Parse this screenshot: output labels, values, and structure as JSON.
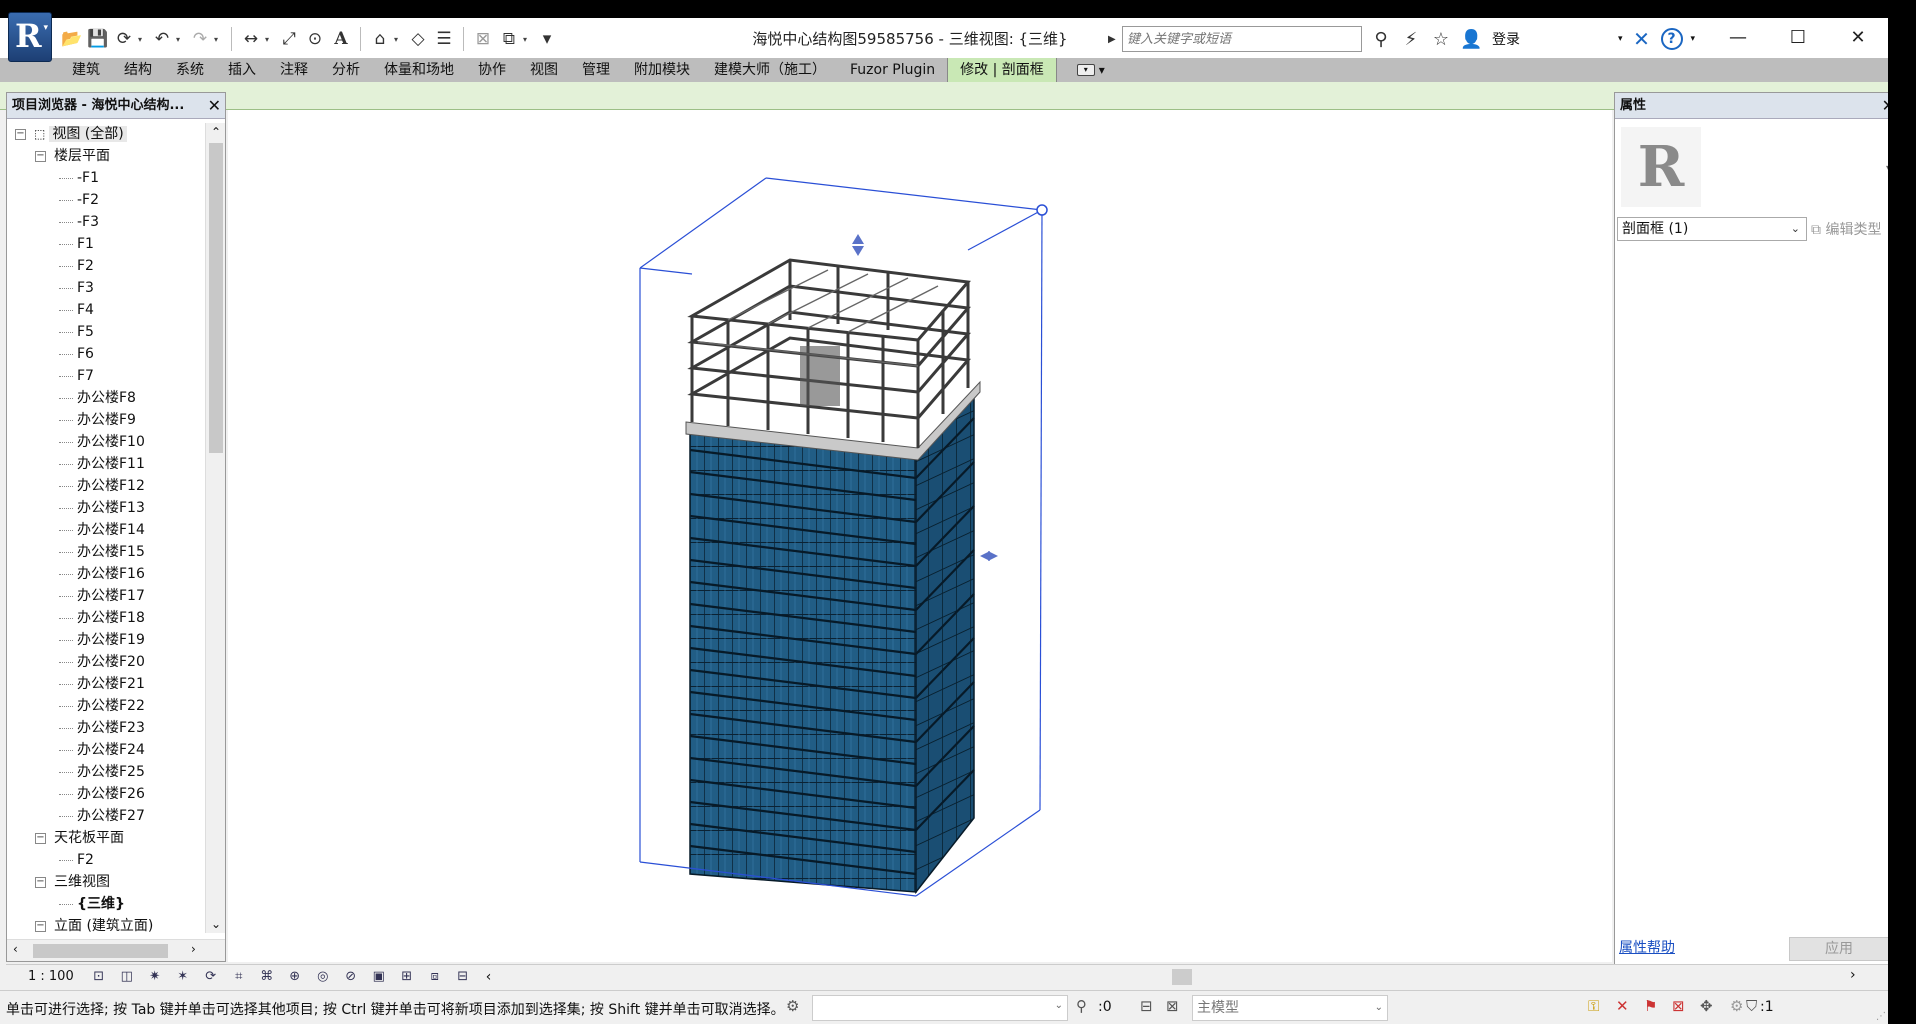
{
  "window": {
    "title": "海悦中心结构图59585756 - 三维视图: {三维}",
    "controls": {
      "minimize": "—",
      "maximize": "☐",
      "close": "✕"
    }
  },
  "app_button": {
    "letter": "R"
  },
  "search": {
    "placeholder": "键入关键字或短语"
  },
  "account": {
    "login_label": "登录"
  },
  "ribbon": {
    "tabs": [
      {
        "label": "建筑",
        "active": false
      },
      {
        "label": "结构",
        "active": false
      },
      {
        "label": "系统",
        "active": false
      },
      {
        "label": "插入",
        "active": false
      },
      {
        "label": "注释",
        "active": false
      },
      {
        "label": "分析",
        "active": false
      },
      {
        "label": "体量和场地",
        "active": false
      },
      {
        "label": "协作",
        "active": false
      },
      {
        "label": "视图",
        "active": false
      },
      {
        "label": "管理",
        "active": false
      },
      {
        "label": "附加模块",
        "active": false
      },
      {
        "label": "建模大师（施工）",
        "active": false
      },
      {
        "label": "Fuzor Plugin",
        "active": false
      },
      {
        "label": "修改 | 剖面框",
        "active": true
      }
    ]
  },
  "browser": {
    "title": "项目浏览器 - 海悦中心结构...",
    "root": "视图 (全部)",
    "floor_plans": {
      "label": "楼层平面",
      "items": [
        "-F1",
        "-F2",
        "-F3",
        "F1",
        "F2",
        "F3",
        "F4",
        "F5",
        "F6",
        "F7",
        "办公楼F8",
        "办公楼F9",
        "办公楼F10",
        "办公楼F11",
        "办公楼F12",
        "办公楼F13",
        "办公楼F14",
        "办公楼F15",
        "办公楼F16",
        "办公楼F17",
        "办公楼F18",
        "办公楼F19",
        "办公楼F20",
        "办公楼F21",
        "办公楼F22",
        "办公楼F23",
        "办公楼F24",
        "办公楼F25",
        "办公楼F26",
        "办公楼F27"
      ]
    },
    "ceiling_plans": {
      "label": "天花板平面",
      "items": [
        "F2"
      ]
    },
    "views_3d": {
      "label": "三维视图",
      "items": [
        "{三维}"
      ]
    },
    "elevations": {
      "label": "立面 (建筑立面)"
    }
  },
  "properties": {
    "title": "属性",
    "type_letter": "R",
    "type_selector": "剖面框 (1)",
    "edit_type_label": "编辑类型",
    "help_link": "属性帮助",
    "apply_label": "应用"
  },
  "view_control": {
    "scale": "1 : 100"
  },
  "status": {
    "message": "单击可进行选择; 按 Tab 键并单击可选择其他项目; 按 Ctrl 键并单击可将新项目添加到选择集; 按 Shift 键并单击可取消选择。",
    "selection_count": ":0",
    "active_model": "主模型",
    "filter_count": ":1"
  },
  "colors": {
    "ribbon_active_tab": "#c9e8b5",
    "context_bar": "#e3f1d8",
    "section_box": "#2a4fd6",
    "glass": "#1f5a80",
    "panel_header": "#dce3ec"
  }
}
